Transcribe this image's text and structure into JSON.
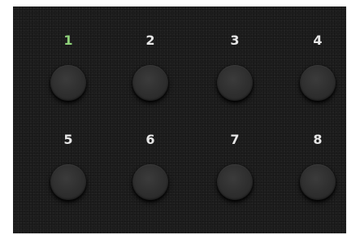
{
  "pads": [
    {
      "label": "1",
      "active": true
    },
    {
      "label": "2",
      "active": false
    },
    {
      "label": "3",
      "active": false
    },
    {
      "label": "4",
      "active": false
    },
    {
      "label": "5",
      "active": false
    },
    {
      "label": "6",
      "active": false
    },
    {
      "label": "7",
      "active": false
    },
    {
      "label": "8",
      "active": false
    }
  ],
  "colors": {
    "background": "#1e1e1e",
    "label": "#e6e6e6",
    "active_label": "#8fd27a",
    "button": "#2e2e2e"
  }
}
